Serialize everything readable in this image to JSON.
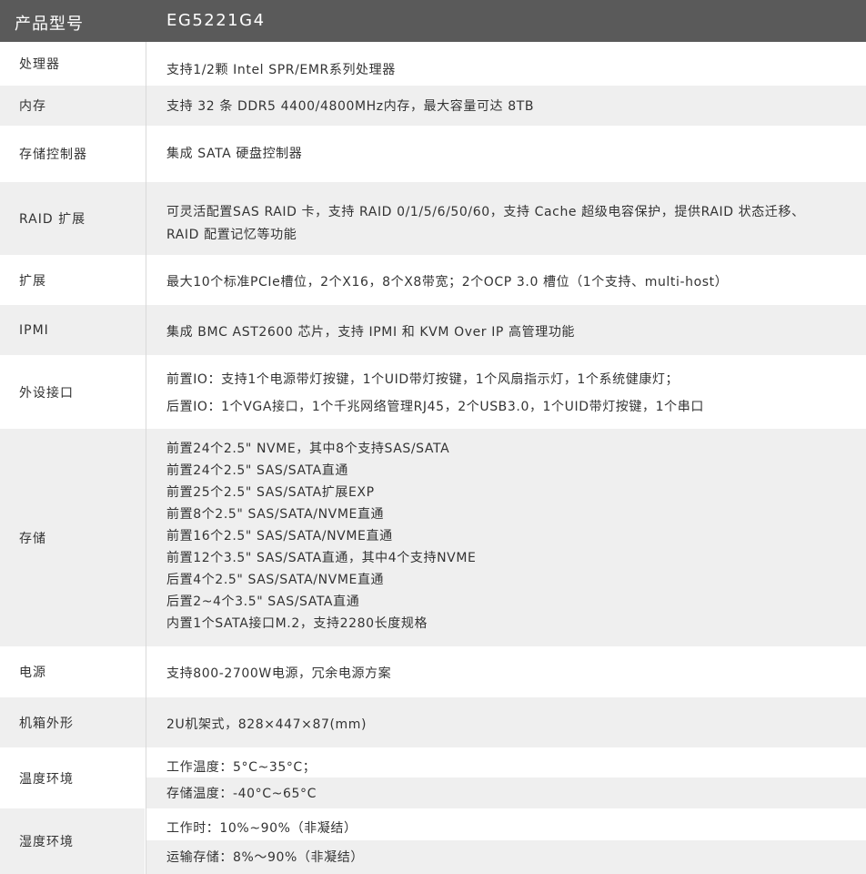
{
  "header": {
    "label": "产品型号",
    "value": "EG5221G4"
  },
  "rows": {
    "cpu": {
      "label": "处理器",
      "lines": [
        "支持1/2颗 Intel SPR/EMR系列处理器"
      ]
    },
    "memory": {
      "label": "内存",
      "lines": [
        "支持 32 条  DDR5 4400/4800MHz内存，最大容量可达 8TB"
      ]
    },
    "storage_controller": {
      "label": "存储控制器",
      "lines": [
        "集成 SATA 硬盘控制器"
      ]
    },
    "raid": {
      "label": "RAID 扩展",
      "lines": [
        "可灵活配置SAS RAID 卡，支持 RAID 0/1/5/6/50/60，支持 Cache 超级电容保护，提供RAID 状态迁移、",
        "RAID 配置记忆等功能"
      ]
    },
    "expansion": {
      "label": "扩展",
      "lines": [
        "最大10个标准PCIe槽位，2个X16，8个X8带宽；2个OCP 3.0 槽位（1个支持、multi-host）"
      ]
    },
    "ipmi": {
      "label": "IPMI",
      "lines": [
        "集成 BMC AST2600 芯片，支持 IPMI 和 KVM Over IP 高管理功能"
      ]
    },
    "peripheral": {
      "label": "外设接口",
      "lines": [
        "前置IO：支持1个电源带灯按键，1个UID带灯按键，1个风扇指示灯，1个系统健康灯；",
        "后置IO：1个VGA接口，1个千兆网络管理RJ45，2个USB3.0，1个UID带灯按键，1个串口"
      ]
    },
    "storage": {
      "label": "存储",
      "lines": [
        "前置24个2.5\" NVME，其中8个支持SAS/SATA",
        "前置24个2.5\" SAS/SATA直通",
        "前置25个2.5\" SAS/SATA扩展EXP",
        "前置8个2.5\" SAS/SATA/NVME直通",
        "前置16个2.5\" SAS/SATA/NVME直通",
        "前置12个3.5\" SAS/SATA直通，其中4个支持NVME",
        "后置4个2.5\" SAS/SATA/NVME直通",
        "后置2~4个3.5\" SAS/SATA直通",
        "内置1个SATA接口M.2，支持2280长度规格"
      ]
    },
    "power": {
      "label": "电源",
      "lines": [
        "支持800-2700W电源，冗余电源方案"
      ]
    },
    "chassis": {
      "label": "机箱外形",
      "lines": [
        "2U机架式，828×447×87(mm)"
      ]
    },
    "temperature": {
      "label": "温度环境",
      "lines": [
        "工作温度：5°C~35°C；",
        "存储温度：-40°C~65°C"
      ]
    },
    "humidity": {
      "label": "湿度环境",
      "lines": [
        "工作时：10%~90%（非凝结）",
        "运输存储：8%～90%（非凝结）"
      ]
    }
  }
}
